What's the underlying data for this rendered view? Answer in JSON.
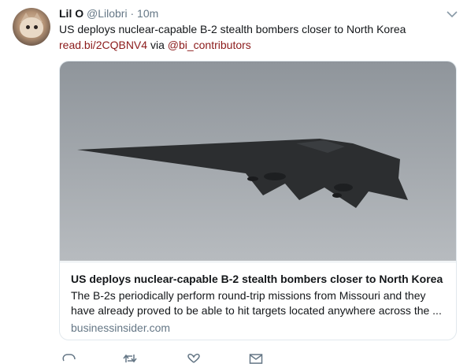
{
  "tweet": {
    "display_name": "Lil O",
    "handle": "@Lilobri",
    "separator": "·",
    "time": "10m",
    "text": "US deploys nuclear-capable B-2 stealth bombers closer to North Korea",
    "link": "read.bi/2CQBNV4",
    "via": " via ",
    "mention": "@bi_contributors"
  },
  "card": {
    "title": "US deploys nuclear-capable B-2 stealth bombers closer to North Korea",
    "description": "The B-2s periodically perform round-trip missions from Missouri and they have already proved to be able to hit targets located anywhere across the ...",
    "domain": "businessinsider.com",
    "image_subject": "B-2 stealth bomber in flight"
  },
  "icons": {
    "caret": "chevron-down-icon",
    "reply": "reply-icon",
    "retweet": "retweet-icon",
    "like": "heart-icon",
    "message": "envelope-icon"
  },
  "colors": {
    "link": "#8b1a1a",
    "muted": "#657786",
    "border": "#e1e8ed",
    "sky_top": "#8f959b",
    "sky_bottom": "#b7bbbf"
  }
}
